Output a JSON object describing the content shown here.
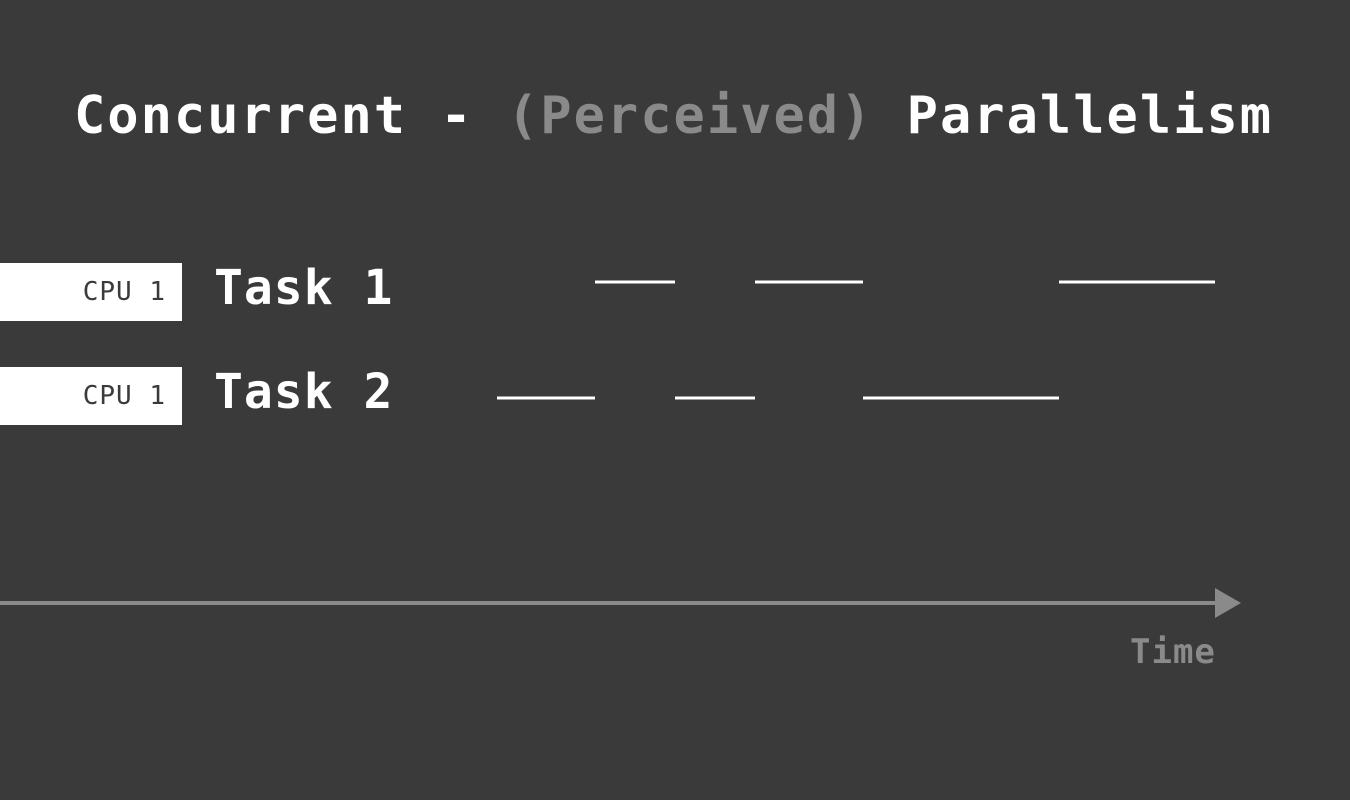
{
  "title": {
    "part1": "Concurrent - ",
    "part2": "(Perceived)",
    "part3": " Parallelism"
  },
  "rows": [
    {
      "cpu_label": "CPU 1",
      "task_label": "Task 1",
      "segments": [
        [
          595,
          675
        ],
        [
          755,
          863
        ],
        [
          1059,
          1215
        ]
      ]
    },
    {
      "cpu_label": "CPU 1",
      "task_label": "Task 2",
      "segments": [
        [
          497,
          595
        ],
        [
          675,
          755
        ],
        [
          863,
          1059
        ]
      ]
    }
  ],
  "axis": {
    "label": "Time",
    "color": "#8a8a8a"
  },
  "colors": {
    "background": "#3a3a3a",
    "foreground": "#ffffff",
    "muted": "#8a8a8a"
  }
}
